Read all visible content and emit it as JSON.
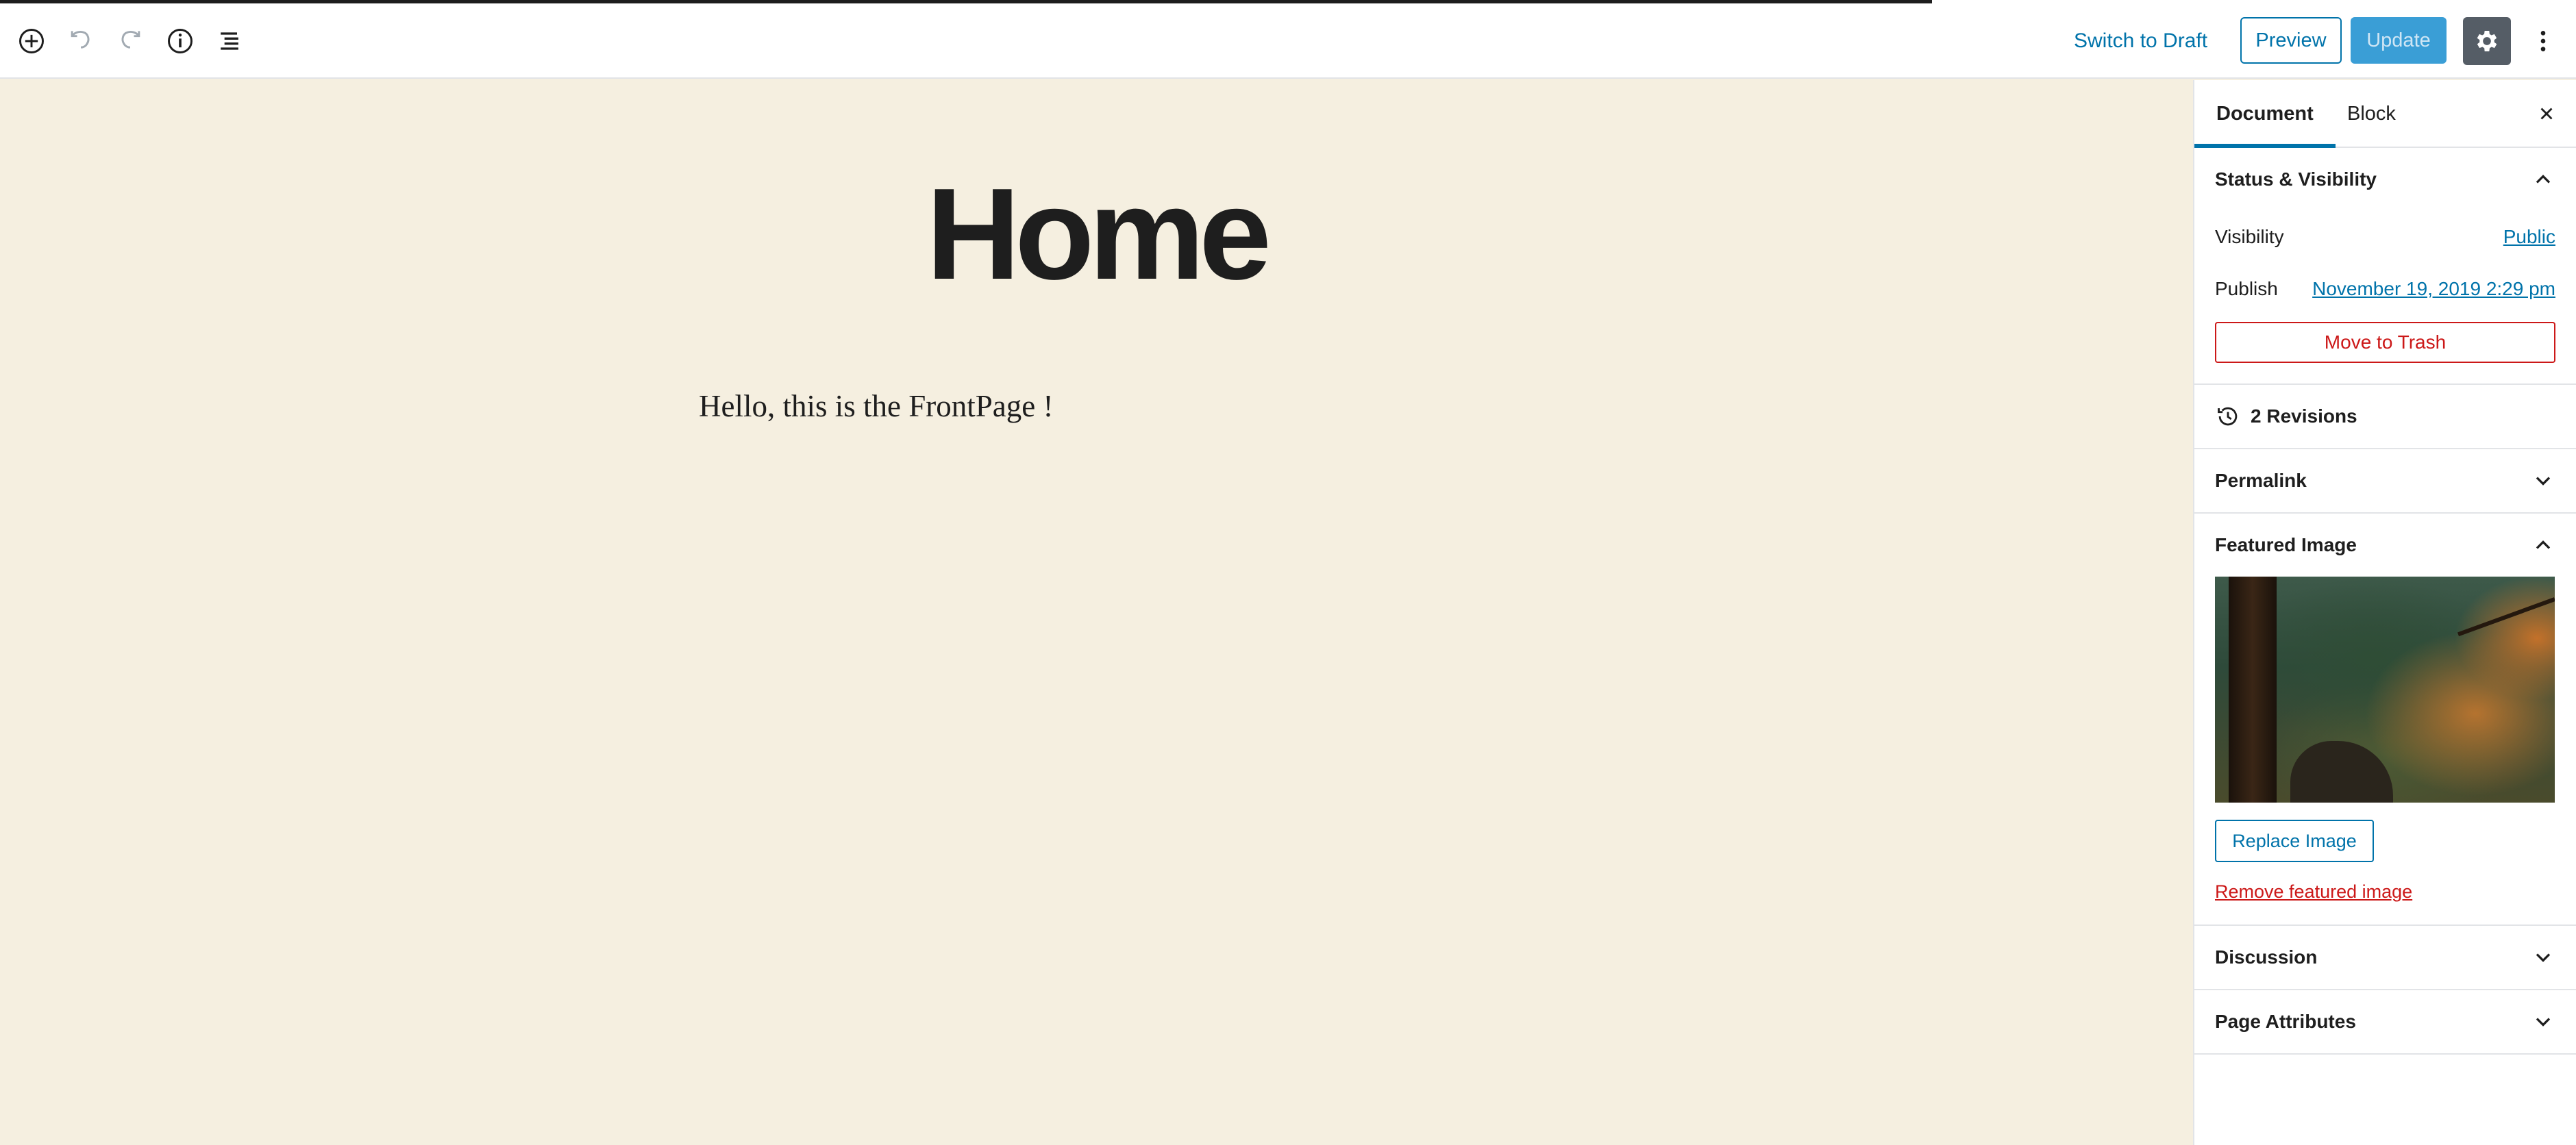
{
  "progress": {
    "fraction": 0.75
  },
  "toolbar": {
    "switch_to_draft": "Switch to Draft",
    "preview": "Preview",
    "update": "Update",
    "icons": [
      "add-block-icon",
      "undo-icon",
      "redo-icon",
      "info-icon",
      "block-navigation-icon",
      "gear-icon",
      "more-vertical-icon"
    ]
  },
  "editor": {
    "title": "Home",
    "paragraph": "Hello, this is the FrontPage !"
  },
  "sidebar": {
    "tabs": [
      {
        "label": "Document",
        "active": true
      },
      {
        "label": "Block",
        "active": false
      }
    ],
    "status": {
      "heading": "Status & Visibility",
      "visibility_label": "Visibility",
      "visibility_value": "Public",
      "publish_label": "Publish",
      "publish_value": "November 19, 2019 2:29 pm",
      "trash": "Move to Trash"
    },
    "revisions": "2 Revisions",
    "permalink": "Permalink",
    "featured": {
      "heading": "Featured Image",
      "replace": "Replace Image",
      "remove": "Remove featured image"
    },
    "discussion": "Discussion",
    "page_attributes": "Page Attributes"
  },
  "colors": {
    "accent": "#0073aa",
    "danger": "#cc1818",
    "canvas": "#f5efe0",
    "update_button": "#3a9ed6"
  }
}
